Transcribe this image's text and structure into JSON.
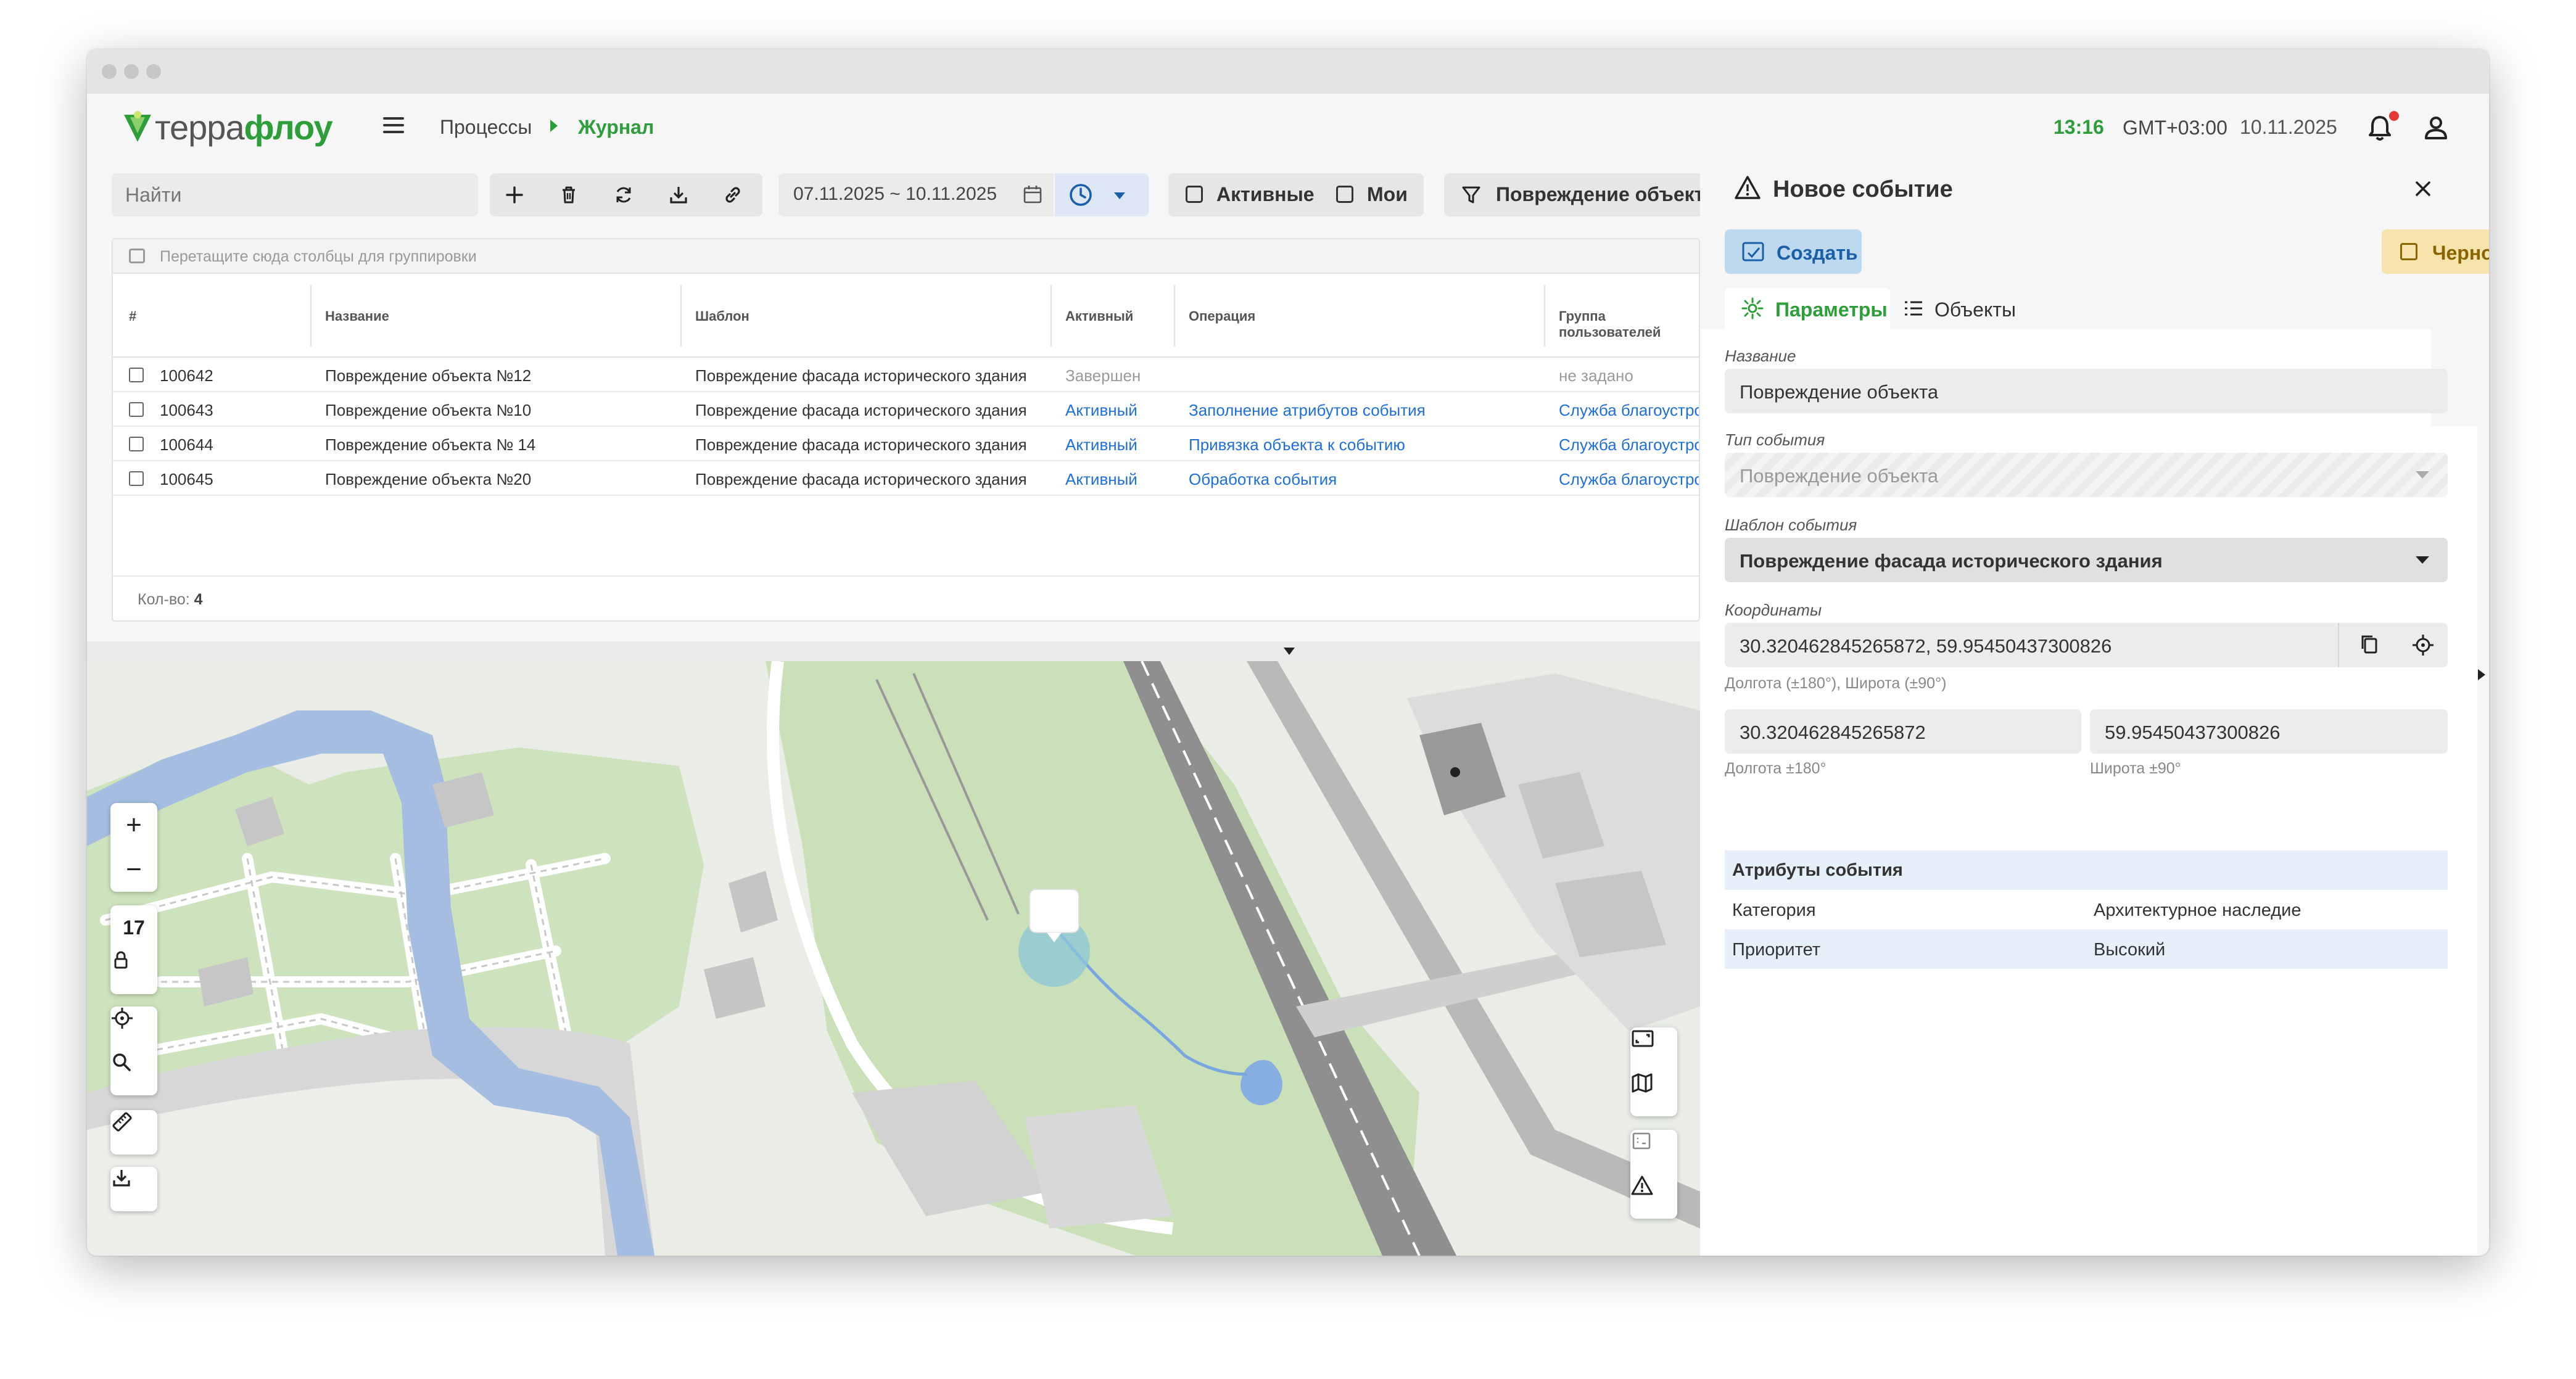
{
  "app": {
    "logo_prefix": "терра",
    "logo_suffix": "флоу",
    "breadcrumb": [
      "Процессы",
      "Журнал"
    ],
    "time": "13:16",
    "timezone": "GMT+03:00",
    "date": "10.11.2025",
    "accent_color": "#2e9e3a",
    "link_color": "#1e6fd9"
  },
  "toolbar": {
    "search_placeholder": "Найти",
    "buttons": [
      "add-icon",
      "trash-icon",
      "refresh-icon",
      "download-icon",
      "link-icon"
    ],
    "date_range": "07.11.2025 ~ 10.11.2025",
    "check_active_label": "Активные",
    "check_mine_label": "Мои",
    "filter_label": "Повреждение объекта"
  },
  "grid": {
    "group_hint": "Перетащите сюда столбцы для группировки",
    "columns": [
      "#",
      "Название",
      "Шаблон",
      "Активный",
      "Операция",
      "Группа пользователей"
    ],
    "rows": [
      {
        "id": "100642",
        "name": "Повреждение объекта №12",
        "template": "Повреждение фасада исторического здания",
        "active": "Завершен",
        "operation": "",
        "group": "не задано"
      },
      {
        "id": "100643",
        "name": "Повреждение объекта №10",
        "template": "Повреждение фасада исторического здания",
        "active": "Активный",
        "operation": "Заполнение атрибутов события",
        "group": "Служба благоустрой"
      },
      {
        "id": "100644",
        "name": "Повреждение объекта № 14",
        "template": "Повреждение фасада исторического здания",
        "active": "Активный",
        "operation": "Привязка объекта к событию",
        "group": "Служба благоустрой"
      },
      {
        "id": "100645",
        "name": "Повреждение объекта №20",
        "template": "Повреждение фасада исторического здания",
        "active": "Активный",
        "operation": "Обработка события",
        "group": "Служба благоустрой"
      }
    ],
    "count_label": "Кол-во:",
    "count_value": "4"
  },
  "map": {
    "zoom_in": "+",
    "zoom_out": "−",
    "zoom_level": "17"
  },
  "panel": {
    "title": "Новое событие",
    "create_label": "Создать",
    "draft_label": "Черновик",
    "tab_params": "Параметры",
    "tab_objects": "Объекты",
    "name_label": "Название",
    "name_value": "Повреждение объекта",
    "type_label": "Тип события",
    "type_value": "Повреждение объекта",
    "template_label": "Шаблон события",
    "template_value": "Повреждение фасада исторического здания",
    "coords_label": "Координаты",
    "coords_value": "30.320462845265872, 59.95450437300826",
    "coords_hint": "Долгота (±180°), Широта (±90°)",
    "lon_value": "30.320462845265872",
    "lon_hint": "Долгота ±180°",
    "lat_value": "59.95450437300826",
    "lat_hint": "Широта ±90°",
    "attrs_title": "Атрибуты события",
    "attrs": [
      {
        "key": "Категория",
        "value": "Архитектурное наследие"
      },
      {
        "key": "Приоритет",
        "value": "Высокий"
      }
    ]
  }
}
